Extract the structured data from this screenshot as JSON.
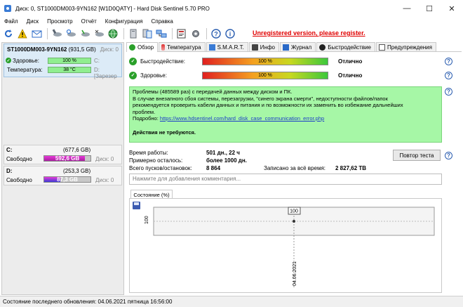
{
  "window": {
    "title": "Диск: 0, ST1000DM003-9YN162 [W1D0QATY]  -  Hard Disk Sentinel 5.70 PRO",
    "minimize": "—",
    "maximize": "☐",
    "close": "✕"
  },
  "menu": [
    "Файл",
    "Диск",
    "Просмотр",
    "Отчёт",
    "Конфигурация",
    "Справка"
  ],
  "toolbar": {
    "unregistered": "Unregistered version, please register."
  },
  "left": {
    "disk": {
      "name": "ST1000DM003-9YN162",
      "size": "(931,5 GB)",
      "index": "Диск: 0",
      "health_label": "Здоровье:",
      "health_value": "100 %",
      "health_note": "C:",
      "temp_label": "Температура:",
      "temp_value": "38 °C",
      "temp_note": "D: [Зарезер"
    },
    "partitions": [
      {
        "letter": "C:",
        "size": "(677,6 GB)",
        "free_label": "Свободно",
        "free_value": "592,6 GB",
        "free_fraction": 0.875,
        "disk": "Диск: 0"
      },
      {
        "letter": "D:",
        "size": "(253,3 GB)",
        "free_label": "Свободно",
        "free_value": "87,3 GB",
        "free_fraction": 0.345,
        "disk": "Диск: 0"
      }
    ]
  },
  "tabs": [
    "Обзор",
    "Температура",
    "S.M.A.R.T.",
    "Инфо",
    "Журнал",
    "Быстродействие",
    "Предупреждения"
  ],
  "overview": {
    "perf_label": "Быстродействие:",
    "perf_value": "100 %",
    "perf_status": "Отлично",
    "health_label": "Здоровье:",
    "health_value": "100 %",
    "health_status": "Отлично",
    "info_line1": "Проблемы (485589 раз) с передачей данных между диском и ПК.",
    "info_line2": "В случае внезапного сбоя системы, перезагрузки, \"синего экрана смерти\", недоступности файлов/папок",
    "info_line3": "рекомендуется проверить кабели данных и питания и по возможности их заменить во избежание дальнейших",
    "info_line4": "проблем.",
    "info_more_label": "Подробно:",
    "info_link": "https://www.hdsentinel.com/hard_disk_case_communication_error.php",
    "info_action": "Действия не требуются.",
    "uptime_label": "Время работы:",
    "uptime_value": "501 дн., 22 ч",
    "remaining_label": "Примерно осталось:",
    "remaining_value": "более 1000 дн.",
    "starts_label": "Всего пусков/остановок:",
    "starts_value": "8 864",
    "written_label": "Записано за всё время:",
    "written_value": "2 827,62 TB",
    "repeat_button": "Повтор теста",
    "comment_placeholder": "Нажмите для добавления комментария...",
    "chart_tab": "Состояние (%)"
  },
  "chart_data": {
    "type": "line",
    "x": [
      "04.06.2021"
    ],
    "y": [
      100
    ],
    "series": [
      {
        "values": [
          100
        ]
      }
    ],
    "ytick_labels": [
      "100"
    ],
    "xtick_labels": [
      "04.06.2021"
    ],
    "data_labels": [
      "100"
    ],
    "grid": true
  },
  "statusbar": {
    "text": "Состояние последнего обновления: 04.06.2021 пятница 16:56:00"
  },
  "colors": {
    "unregistered": "#e00000",
    "info_bg": "#a6f7a6",
    "partition_fill": "#d62ac8"
  }
}
